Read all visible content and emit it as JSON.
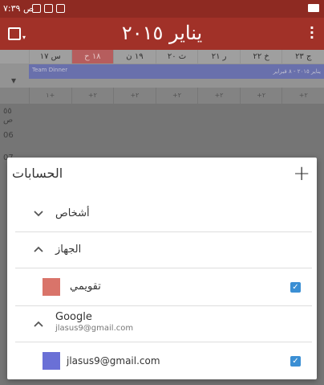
{
  "status_bar": {
    "time": "۷:۳۹ ص"
  },
  "app_bar": {
    "title": "يناير ٢٠١٥"
  },
  "calendar": {
    "days": [
      {
        "label": "س ١٧",
        "today": false
      },
      {
        "label": "١٨ ح",
        "today": true
      },
      {
        "label": "١٩ ن",
        "today": false
      },
      {
        "label": "ث ٢٠",
        "today": false
      },
      {
        "label": "ر ٢١",
        "today": false
      },
      {
        "label": "خ ٢٢",
        "today": false
      },
      {
        "label": "ج ٢٣",
        "today": false
      }
    ],
    "event": {
      "name": "Team Dinner",
      "right_text": "يناير ٢٠١٥ - ٨ فبراير"
    },
    "add_counts": [
      "١+",
      "+٢",
      "+٢",
      "+٢",
      "+٢",
      "+٢",
      "+٢"
    ],
    "hours": [
      "٥٥ ص",
      "06",
      "07"
    ]
  },
  "dialog": {
    "title": "الحسابات",
    "add_symbol": "+",
    "sections": {
      "people": {
        "label": "أشخاص"
      },
      "device": {
        "label": "الجهاز"
      },
      "my_calendar": {
        "label": "تقويمي",
        "color": "#d9746a"
      },
      "google": {
        "label": "Google",
        "email": "jlasus9@gmail.com"
      },
      "google_calendar": {
        "label": "jlasus9@gmail.com",
        "color": "#6a70d6"
      }
    }
  },
  "colors": {
    "status_bar": "#8e2a22",
    "app_bar": "#a13128",
    "checkbox": "#3b8fd4"
  }
}
